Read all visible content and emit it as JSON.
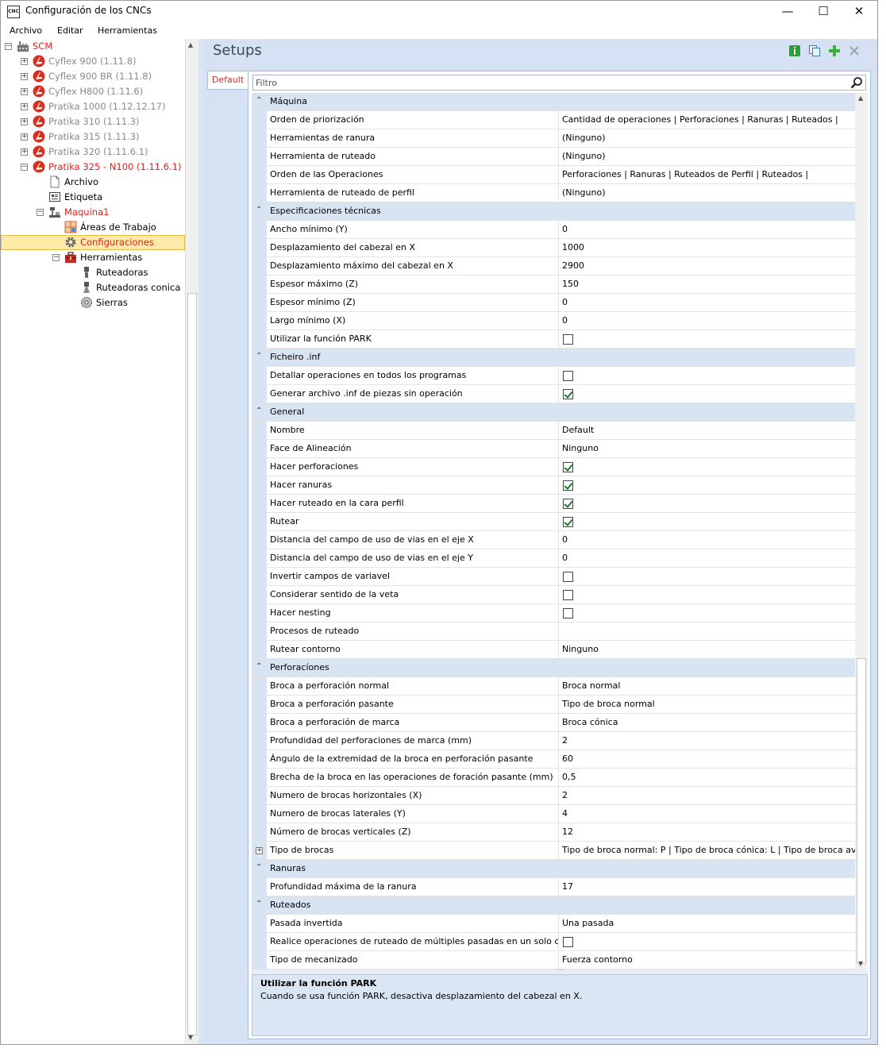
{
  "window": {
    "title": "Configuración de los CNCs",
    "app_icon_text": "CNC",
    "minimize_glyph": "—",
    "maximize_glyph": "☐",
    "close_glyph": "✕"
  },
  "menu": [
    "Archivo",
    "Editar",
    "Herramientas"
  ],
  "tree": {
    "root": "SCM",
    "machines": [
      {
        "label": "Cyflex 900 (1.11.8)",
        "state": "disabled"
      },
      {
        "label": "Cyflex 900 BR (1.11.8)",
        "state": "disabled"
      },
      {
        "label": "Cyflex H800 (1.11.6)",
        "state": "disabled"
      },
      {
        "label": "Pratika 1000 (1.12.12.17)",
        "state": "disabled"
      },
      {
        "label": "Pratika 310 (1.11.3)",
        "state": "disabled"
      },
      {
        "label": "Pratika 315 (1.11.3)",
        "state": "disabled"
      },
      {
        "label": "Pratika 320 (1.11.6.1)",
        "state": "disabled"
      },
      {
        "label": "Pratika 325 - N100 (1.11.6.1)",
        "state": "active"
      }
    ],
    "active_children": {
      "archivo": "Archivo",
      "etiqueta": "Etiqueta",
      "maquina": "Maquina1",
      "areas": "Áreas de Trabajo",
      "configuraciones": "Configuraciones",
      "herramientas": "Herramientas",
      "ruteadoras": "Ruteadoras",
      "ruteadoras_conica": "Ruteadoras conica",
      "sierras": "Sierras"
    }
  },
  "setups": {
    "title": "Setups",
    "tab": "Default",
    "filter_placeholder": "Filtro"
  },
  "grid": [
    {
      "type": "category",
      "label": "Máquina"
    },
    {
      "type": "text",
      "name": "Orden de priorización",
      "value": "Cantidad de operaciones | Perforaciones | Ranuras | Ruteados |"
    },
    {
      "type": "text",
      "name": "Herramientas de ranura",
      "value": "(Ninguno)"
    },
    {
      "type": "text",
      "name": "Herramienta de ruteado",
      "value": "(Ninguno)"
    },
    {
      "type": "text",
      "name": "Orden de las Operaciones",
      "value": "Perforaciones | Ranuras | Ruteados de Perfil | Ruteados |"
    },
    {
      "type": "text",
      "name": "Herramienta de ruteado de perfil",
      "value": "(Ninguno)"
    },
    {
      "type": "category",
      "label": "Especificaciones técnicas"
    },
    {
      "type": "text",
      "name": "Ancho mínimo (Y)",
      "value": "0"
    },
    {
      "type": "text",
      "name": "Desplazamiento del cabezal en X",
      "value": "1000"
    },
    {
      "type": "text",
      "name": "Desplazamiento máximo del cabezal en X",
      "value": "2900"
    },
    {
      "type": "text",
      "name": "Espesor máximo (Z)",
      "value": "150"
    },
    {
      "type": "text",
      "name": "Espesor mínimo (Z)",
      "value": "0"
    },
    {
      "type": "text",
      "name": "Largo mínimo (X)",
      "value": "0"
    },
    {
      "type": "bool",
      "name": "Utilizar la función PARK",
      "checked": false
    },
    {
      "type": "category",
      "label": "Ficheiro .inf"
    },
    {
      "type": "bool",
      "name": "Detallar operaciones en todos los programas",
      "checked": false
    },
    {
      "type": "bool",
      "name": "Generar archivo .inf de piezas sin operación",
      "checked": true
    },
    {
      "type": "category",
      "label": "General"
    },
    {
      "type": "text",
      "name": "Nombre",
      "value": "Default"
    },
    {
      "type": "text",
      "name": "Face de Alineación",
      "value": "Ninguno"
    },
    {
      "type": "bool",
      "name": "Hacer perforaciones",
      "checked": true
    },
    {
      "type": "bool",
      "name": "Hacer ranuras",
      "checked": true
    },
    {
      "type": "bool",
      "name": "Hacer ruteado en la cara perfil",
      "checked": true
    },
    {
      "type": "bool",
      "name": "Rutear",
      "checked": true
    },
    {
      "type": "text",
      "name": "Distancia del campo de uso de vias en el eje X",
      "value": "0"
    },
    {
      "type": "text",
      "name": "Distancia del campo de uso de vias en el eje Y",
      "value": "0"
    },
    {
      "type": "bool",
      "name": "Invertir campos de variavel",
      "checked": false
    },
    {
      "type": "bool",
      "name": "Considerar sentido de la veta",
      "checked": false
    },
    {
      "type": "bool",
      "name": "Hacer nesting",
      "checked": false
    },
    {
      "type": "text",
      "name": "Procesos de ruteado",
      "value": ""
    },
    {
      "type": "text",
      "name": "Rutear contorno",
      "value": "Ninguno"
    },
    {
      "type": "category",
      "label": "Perforacíones"
    },
    {
      "type": "text",
      "name": "Broca a perforación normal",
      "value": "Broca normal"
    },
    {
      "type": "text",
      "name": "Broca a perforación pasante",
      "value": "Tipo de broca normal"
    },
    {
      "type": "text",
      "name": "Broca a perforación de marca",
      "value": "Broca cónica"
    },
    {
      "type": "text",
      "name": "Profundidad del perforaciones de marca (mm)",
      "value": "2"
    },
    {
      "type": "text",
      "name": "Ángulo de la extremidad de la broca en perforación pasante",
      "value": "60"
    },
    {
      "type": "text",
      "name": "Brecha de la broca en las operaciones de foración pasante (mm)",
      "value": "0,5"
    },
    {
      "type": "text",
      "name": "Numero de brocas horizontales (X)",
      "value": "2"
    },
    {
      "type": "text",
      "name": "Numero de brocas laterales (Y)",
      "value": "4"
    },
    {
      "type": "text",
      "name": "Número de brocas verticales (Z)",
      "value": "12"
    },
    {
      "type": "expandable",
      "name": "Tipo de brocas",
      "value": "Tipo de broca normal: P  |  Tipo de broca cónica: L  |  Tipo de broca avella"
    },
    {
      "type": "category",
      "label": "Ranuras"
    },
    {
      "type": "text",
      "name": "Profundidad máxima de la ranura",
      "value": "17"
    },
    {
      "type": "category",
      "label": "Ruteados"
    },
    {
      "type": "text",
      "name": "Pasada invertida",
      "value": "Una pasada"
    },
    {
      "type": "bool",
      "name": "Realice operaciones de ruteado de múltiples pasadas en un solo coman...",
      "checked": false
    },
    {
      "type": "text",
      "name": "Tipo de mecanizado",
      "value": "Fuerza contorno"
    }
  ],
  "help": {
    "title": "Utilizar la función PARK",
    "description": "Cuando se usa función PARK, desactiva desplazamiento del cabezal en X."
  }
}
